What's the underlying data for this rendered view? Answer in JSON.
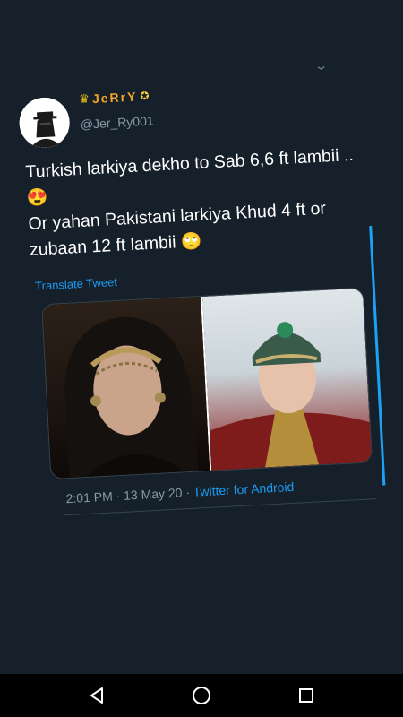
{
  "tweet": {
    "display_name": "JeRrY",
    "handle": "@Jer_Ry001",
    "text_line1": "Turkish larkiya dekho to Sab 6,6 ft lambii .. ",
    "emoji1": "😍",
    "text_line2": "Or yahan Pakistani larkiya Khud 4 ft or zubaan 12 ft lambii ",
    "emoji2": "🙄",
    "translate_label": "Translate Tweet",
    "time": "2:01 PM",
    "date": "13 May 20",
    "source": "Twitter for Android",
    "separator": " · "
  },
  "icons": {
    "more": "chevron-down-icon",
    "nav_back": "back-icon",
    "nav_home": "home-icon",
    "nav_recents": "recents-icon"
  },
  "colors": {
    "background": "#15202b",
    "link": "#1d9bf0",
    "name_gold": "#f5a623",
    "secondary_text": "#8899a6"
  }
}
